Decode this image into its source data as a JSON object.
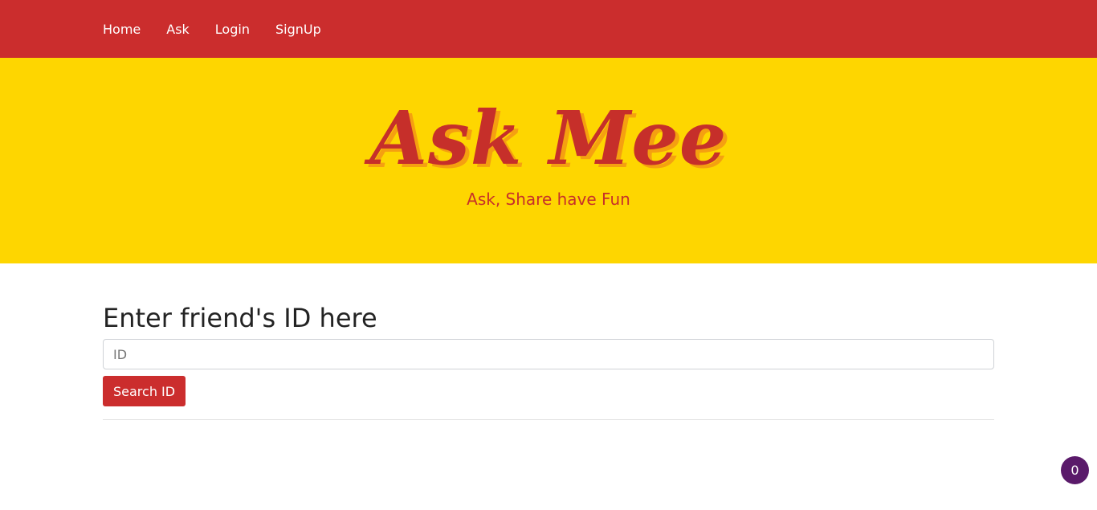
{
  "nav": {
    "items": [
      {
        "label": "Home"
      },
      {
        "label": "Ask"
      },
      {
        "label": "Login"
      },
      {
        "label": "SignUp"
      }
    ]
  },
  "hero": {
    "title": "Ask Mee",
    "subtitle": "Ask, Share have Fun"
  },
  "search": {
    "heading": "Enter friend's ID here",
    "placeholder": "ID",
    "value": "",
    "button_label": "Search ID"
  },
  "badge": {
    "count": "0"
  },
  "colors": {
    "navbar": "#cb2d2d",
    "hero_background": "#fed600",
    "accent": "#c62f2a",
    "badge": "#5a1a6a"
  }
}
